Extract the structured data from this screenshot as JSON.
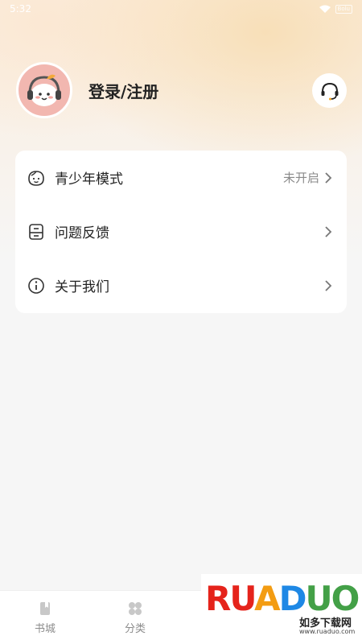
{
  "status_bar": {
    "time": "5:32",
    "battery": "Bolu"
  },
  "profile": {
    "login_label": "登录/注册"
  },
  "menu": [
    {
      "label": "青少年模式",
      "value": "未开启",
      "icon": "face-icon"
    },
    {
      "label": "问题反馈",
      "value": "",
      "icon": "feedback-icon"
    },
    {
      "label": "关于我们",
      "value": "",
      "icon": "info-icon"
    }
  ],
  "tabs": [
    {
      "label": "书城",
      "icon": "book-icon"
    },
    {
      "label": "分类",
      "icon": "grid-icon"
    }
  ],
  "watermark": {
    "logo": "RUANDUO",
    "subtitle": "如多下载网",
    "url": "www.ruaduo.com"
  },
  "colors": {
    "accent_bg": "#fbeee0",
    "avatar_bg": "#f2b7b0",
    "text": "#222222",
    "muted": "#8a8a8a"
  }
}
